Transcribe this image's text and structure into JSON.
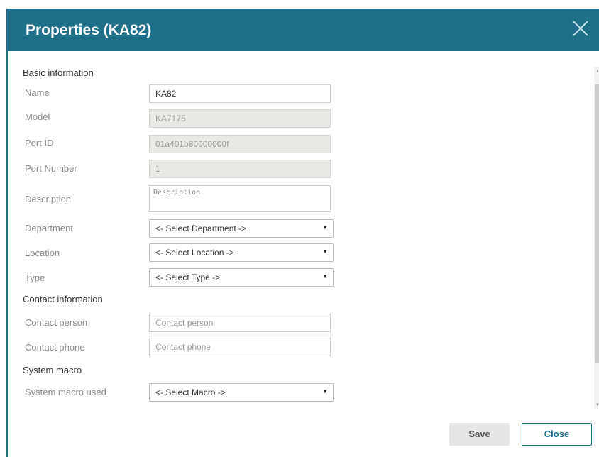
{
  "dialog": {
    "title": "Properties (KA82)",
    "close_icon": "close-icon"
  },
  "basic": {
    "heading": "Basic information",
    "name_label": "Name",
    "name_value": "KA82",
    "model_label": "Model",
    "model_value": "KA7175",
    "port_id_label": "Port ID",
    "port_id_value": "01a401b80000000f",
    "port_number_label": "Port Number",
    "port_number_value": "1",
    "description_label": "Description",
    "description_placeholder": "Description",
    "department_label": "Department",
    "department_value": "<- Select Department ->",
    "location_label": "Location",
    "location_value": "<- Select Location ->",
    "type_label": "Type",
    "type_value": "<- Select Type ->"
  },
  "contact": {
    "heading": "Contact information",
    "person_label": "Contact person",
    "person_placeholder": "Contact person",
    "phone_label": "Contact phone",
    "phone_placeholder": "Contact phone"
  },
  "macro": {
    "heading": "System macro",
    "used_label": "System macro used",
    "used_value": "<- Select Macro ->"
  },
  "select_arrow": "▼",
  "buttons": {
    "save": "Save",
    "close": "Close"
  },
  "colors": {
    "titlebar": "#1f6f8b",
    "readonly_bg": "#e9e9e6"
  }
}
